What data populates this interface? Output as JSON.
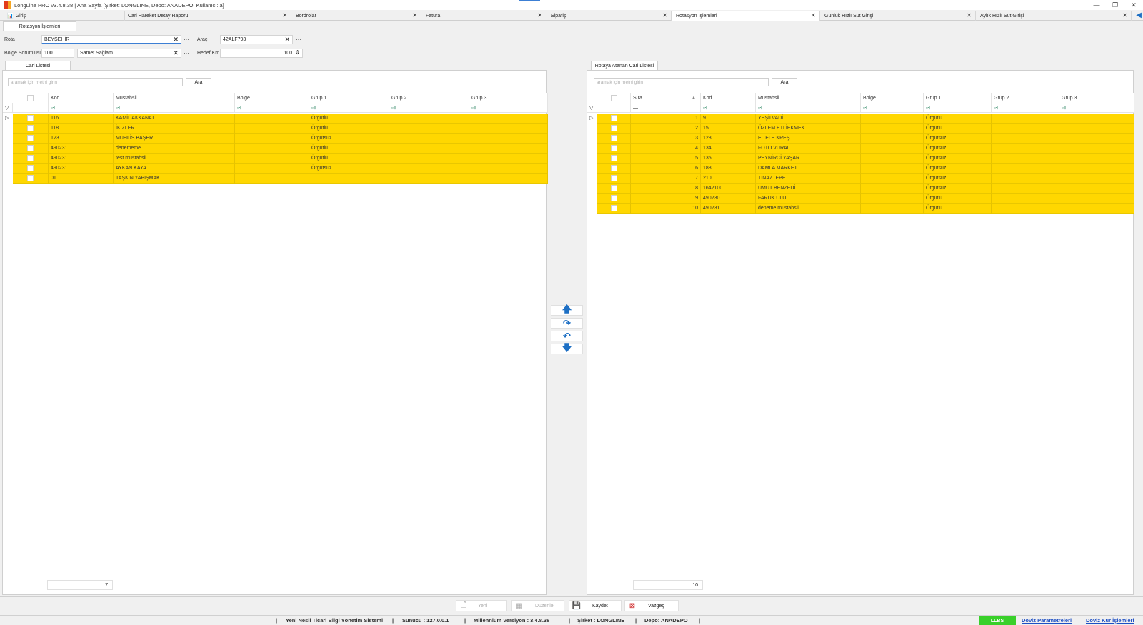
{
  "window": {
    "title": "LongLine PRO v3.4.8.38 | Ana Sayfa [Şirket: LONGLINE, Depo: ANADEPO, Kullanıcı: a]",
    "minimize": "—",
    "restore": "❐",
    "close": "✕"
  },
  "tabs": [
    {
      "label": "Giriş",
      "close": ""
    },
    {
      "label": "Cari Hareket Detay Raporu",
      "close": "✕"
    },
    {
      "label": "Bordrolar",
      "close": "✕"
    },
    {
      "label": "Fatura",
      "close": "✕"
    },
    {
      "label": "Sipariş",
      "close": "✕"
    },
    {
      "label": "Rotasyon İşlemleri",
      "close": "✕"
    },
    {
      "label": "Günlük Hızlı Süt Girişi",
      "close": "✕"
    },
    {
      "label": "Aylık Hızlı Süt Girişi",
      "close": "✕"
    }
  ],
  "subtab": "Rotasyon İşlemleri",
  "form": {
    "rota_label": "Rota",
    "rota_value": "BEYŞEHİR",
    "arac_label": "Araç",
    "arac_value": "42ALF793",
    "bolge_label": "Bölge Sorumlusu",
    "bolge_code": "100",
    "bolge_name": "Samet Sağlam",
    "hedef_label": "Hedef Km",
    "hedef_value": "100",
    "clear": "✕",
    "ellipsis": "···"
  },
  "left": {
    "tab": "Cari Listesi",
    "search_placeholder": "aramak için metni girin",
    "search_button": "Ara",
    "columns": [
      "Kod",
      "Müstahsil",
      "Bölge",
      "Grup 1",
      "Grup 2",
      "Grup 3"
    ],
    "filter_icon": "▽",
    "filter_cell_icon": "▫꜊",
    "row_indicator": "▷",
    "rows": [
      {
        "kod": "116",
        "mustahsil": "KAMİL AKKANAT",
        "bolge": "",
        "grup1": "Örgütlü"
      },
      {
        "kod": "118",
        "mustahsil": "İKİZLER",
        "bolge": "",
        "grup1": "Örgütlü"
      },
      {
        "kod": "123",
        "mustahsil": "MUHLİS BAŞER",
        "bolge": "",
        "grup1": "Örgütsüz"
      },
      {
        "kod": "490231",
        "mustahsil": "denememe",
        "bolge": "",
        "grup1": "Örgütlü"
      },
      {
        "kod": "490231",
        "mustahsil": "test müstahsil",
        "bolge": "",
        "grup1": "Örgütlü"
      },
      {
        "kod": "490231",
        "mustahsil": "AYKAN KAYA",
        "bolge": "",
        "grup1": "Örgütsüz"
      },
      {
        "kod": "01",
        "mustahsil": "TAŞKIN YAPIŞMAK",
        "bolge": "",
        "grup1": ""
      }
    ],
    "count": "7"
  },
  "right": {
    "tab": "Rotaya Atanan Cari Listesi",
    "search_placeholder": "aramak için metni girin",
    "search_button": "Ara",
    "columns": [
      "Sıra",
      "Kod",
      "Müstahsil",
      "Bölge",
      "Grup 1",
      "Grup 2",
      "Grup 3"
    ],
    "sira_filter": "—",
    "sort_icon": "▲",
    "rows": [
      {
        "sira": "1",
        "kod": "9",
        "mustahsil": "YEŞİLVADİ",
        "grup1": "Örgütlü"
      },
      {
        "sira": "2",
        "kod": "15",
        "mustahsil": "ÖZLEM ETLİEKMEK",
        "grup1": "Örgütlü"
      },
      {
        "sira": "3",
        "kod": "128",
        "mustahsil": "EL ELE KREŞ",
        "grup1": "Örgütsüz"
      },
      {
        "sira": "4",
        "kod": "134",
        "mustahsil": "FOTO VURAL",
        "grup1": "Örgütsüz"
      },
      {
        "sira": "5",
        "kod": "135",
        "mustahsil": "PEYNİRCİ YAŞAR",
        "grup1": "Örgütsüz"
      },
      {
        "sira": "6",
        "kod": "188",
        "mustahsil": "DAMLA MARKET",
        "grup1": "Örgütsüz"
      },
      {
        "sira": "7",
        "kod": "210",
        "mustahsil": "TINAZTEPE",
        "grup1": "Örgütsüz"
      },
      {
        "sira": "8",
        "kod": "1642100",
        "mustahsil": "UMUT BENZEDİ",
        "grup1": "Örgütsüz"
      },
      {
        "sira": "9",
        "kod": "490230",
        "mustahsil": "FARUK ULU",
        "grup1": "Örgütlü"
      },
      {
        "sira": "10",
        "kod": "490231",
        "mustahsil": "deneme müstahsil",
        "grup1": "Örgütlü"
      }
    ],
    "count": "10"
  },
  "arrows": {
    "up": "🡅",
    "forward": "↷",
    "back": "↶",
    "down": "🡇"
  },
  "actions": {
    "yeni": "Yeni",
    "duzenle": "Düzenle",
    "kaydet": "Kaydet",
    "vazgec": "Vazgeç"
  },
  "status": {
    "system": "Yeni Nesil Ticari Bilgi Yönetim Sistemi",
    "sunucu": "Sunucu :  127.0.0.1",
    "version": "Millennium Versiyon :   3.4.8.38",
    "sirket": "Şirket :  LONGLINE",
    "depo": "Depo:  ANADEPO",
    "sep": "|",
    "llbs": "LLBS",
    "doviz_param": "Döviz Parametreleri",
    "doviz_kur": "Döviz Kur İşlemleri"
  },
  "colors": {
    "row_highlight": "#ffd700",
    "accent": "#3c7fd4",
    "arrow": "#1d6fc4",
    "llbs": "#39d02a"
  }
}
